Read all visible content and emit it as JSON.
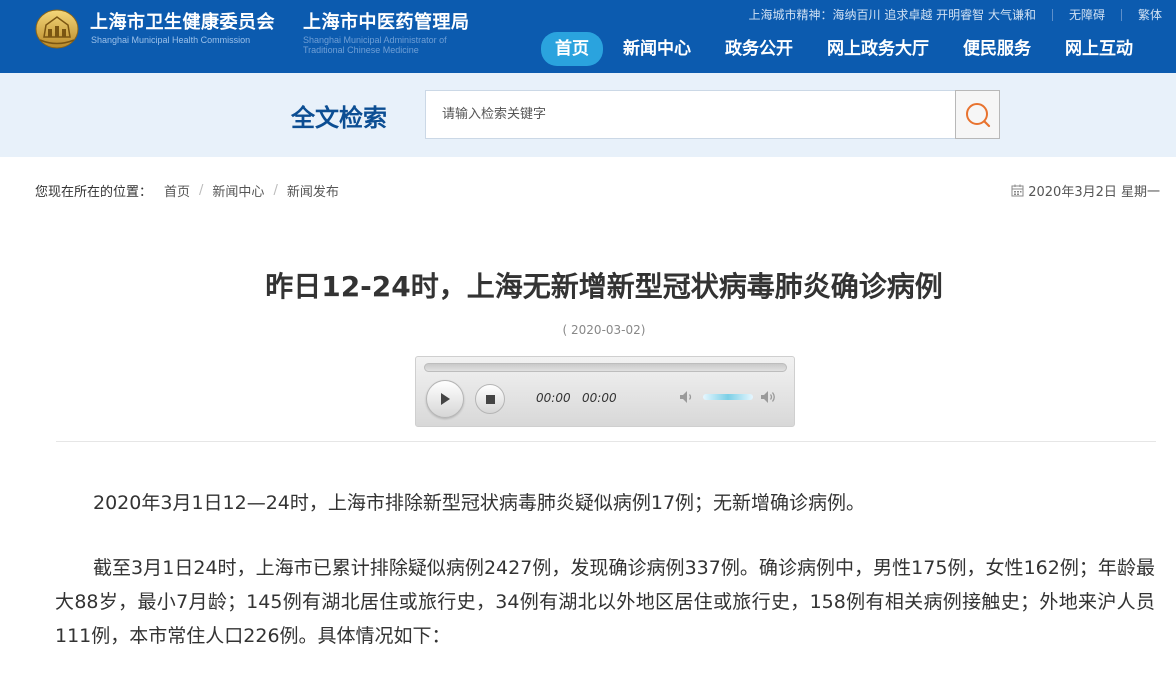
{
  "header": {
    "org1_cn": "上海市卫生健康委员会",
    "org1_en": "Shanghai Municipal Health Commission",
    "org2_cn": "上海市中医药管理局",
    "org2_en_line1": "Shanghai Municipal Administrator of",
    "org2_en_line2": "Traditional Chinese Medicine",
    "city_spirit": "上海城市精神：海纳百川 追求卓越 开明睿智 大气谦和",
    "accessibility": "无障碍",
    "traditional": "繁体",
    "nav": [
      {
        "label": "首页",
        "active": true
      },
      {
        "label": "新闻中心",
        "active": false
      },
      {
        "label": "政务公开",
        "active": false
      },
      {
        "label": "网上政务大厅",
        "active": false
      },
      {
        "label": "便民服务",
        "active": false
      },
      {
        "label": "网上互动",
        "active": false
      }
    ]
  },
  "search": {
    "title": "全文检索",
    "placeholder": "请输入检索关键字"
  },
  "breadcrumb": {
    "lead": "您现在所在的位置：",
    "items": [
      "首页",
      "新闻中心",
      "新闻发布"
    ],
    "date": "2020年3月2日 星期一"
  },
  "article": {
    "title": "昨日12-24时，上海无新增新型冠状病毒肺炎确诊病例",
    "date": "( 2020-03-02)",
    "player": {
      "current_time": "00:00",
      "total_time": "00:00"
    },
    "paragraphs": [
      "2020年3月1日12—24时，上海市排除新型冠状病毒肺炎疑似病例17例；无新增确诊病例。",
      "截至3月1日24时，上海市已累计排除疑似病例2427例，发现确诊病例337例。确诊病例中，男性175例，女性162例；年龄最大88岁，最小7月龄；145例有湖北居住或旅行史，34例有湖北以外地区居住或旅行史，158例有相关病例接触史；外地来沪人员111例，本市常住人口226例。具体情况如下："
    ]
  },
  "colors": {
    "header_bg": "#0c5baf",
    "nav_active": "#2aa3de",
    "search_band": "#e8f1fa",
    "search_title": "#0c4e93",
    "search_icon": "#e8732f"
  },
  "icons": {
    "logo": "municipal-emblem-icon",
    "search": "search-icon",
    "calendar": "calendar-icon",
    "play": "play-icon",
    "stop": "stop-icon",
    "volume_low": "volume-low-icon",
    "volume_high": "volume-high-icon"
  }
}
